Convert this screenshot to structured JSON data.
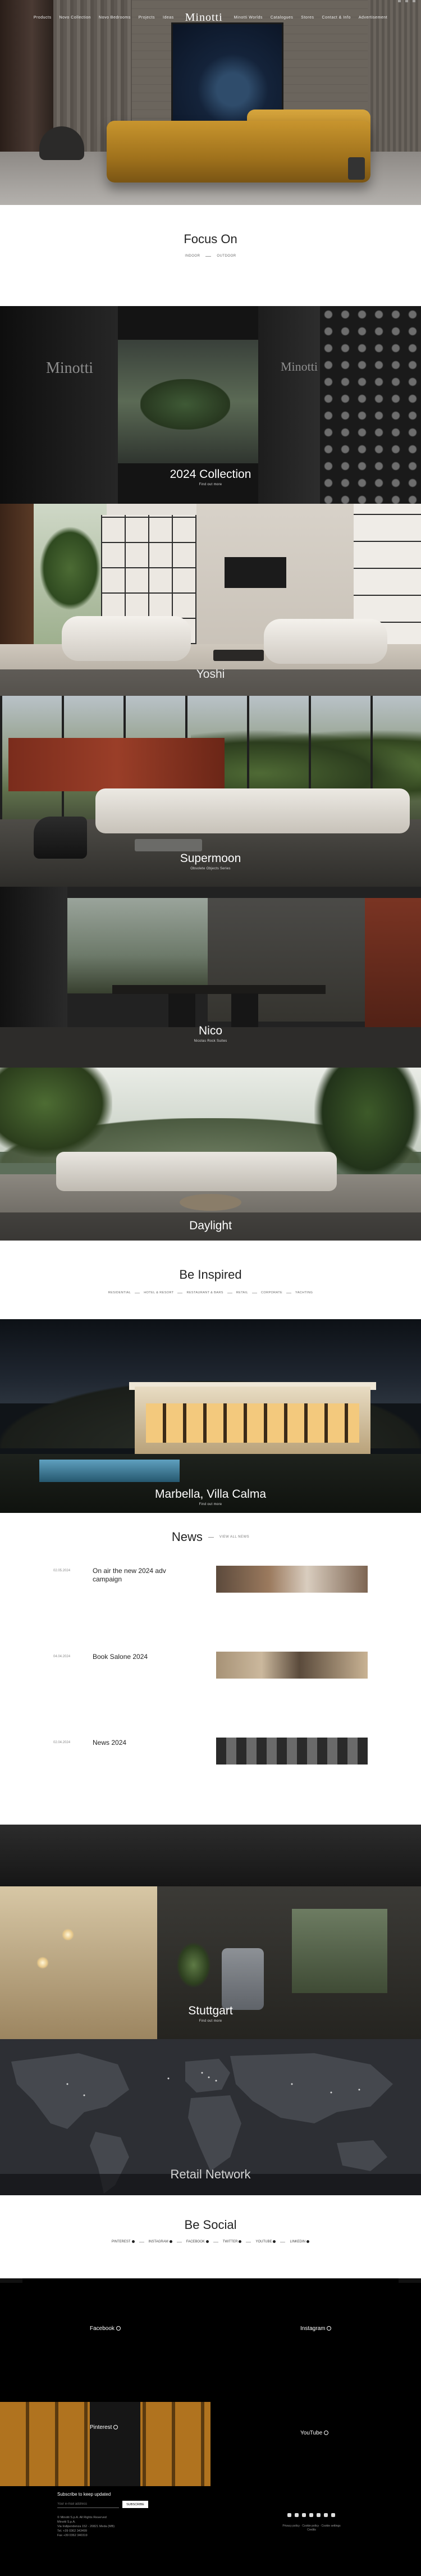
{
  "header": {
    "logo": "Minotti",
    "nav_left": [
      "Products",
      "Novo Collection",
      "Novo Bedrooms",
      "Projects",
      "Ideas"
    ],
    "nav_right": [
      "Minotti Worlds",
      "Catalogues",
      "Stores",
      "Contact & Info",
      "Advertisement"
    ]
  },
  "focus_on": {
    "title": "Focus On",
    "tabs": [
      "INDOOR",
      "OUTDOOR"
    ],
    "panels": [
      {
        "title": "2024 Collection",
        "subtitle": "Find out more"
      },
      {
        "title": "Yoshi",
        "subtitle": ""
      },
      {
        "title": "Supermoon",
        "subtitle": "Obsolete Objects Series"
      },
      {
        "title": "Nico",
        "subtitle": "Nicolas Rock Suites"
      },
      {
        "title": "Daylight",
        "subtitle": ""
      }
    ]
  },
  "be_inspired": {
    "title": "Be Inspired",
    "chips": [
      "RESIDENTIAL",
      "HOTEL & RESORT",
      "RESTAURANT & BARS",
      "RETAIL",
      "CORPORATE",
      "YACHTING"
    ],
    "feature": {
      "title": "Marbella, Villa Calma",
      "subtitle": "Find out more"
    }
  },
  "news": {
    "title": "News",
    "view_all": "VIEW ALL NEWS",
    "items": [
      {
        "date": "02.05.2024",
        "title": "On air the new 2024 adv campaign"
      },
      {
        "date": "04.04.2024",
        "title": "Book Salone 2024"
      },
      {
        "date": "02.04.2024",
        "title": "News 2024"
      }
    ]
  },
  "store": {
    "title": "Stuttgart",
    "subtitle": "Find out more"
  },
  "map": {
    "title": "Retail Network"
  },
  "be_social": {
    "title": "Be Social",
    "links": [
      "PINTEREST",
      "INSTAGRAM",
      "FACEBOOK",
      "TWITTER",
      "YOUTUBE",
      "LINKEDIN"
    ],
    "tiles": [
      "Facebook",
      "Instagram",
      "Pinterest",
      "YouTube"
    ]
  },
  "footer": {
    "subscribe_label": "Subscribe to keep updated",
    "email_placeholder": "Your e-mail address",
    "subscribe_button": "SUBSCRIBE",
    "address": "© Minotti S.p.A. All Rights Reserved\nMinotti S.p.A.\nVia Indipendenza 152 - 20821 Meda (MB)\nTel. +39 0362 343499\nFax +39 0362 340319",
    "legal": "Privacy policy · Cookie policy · Cookie settings\nCredits"
  }
}
